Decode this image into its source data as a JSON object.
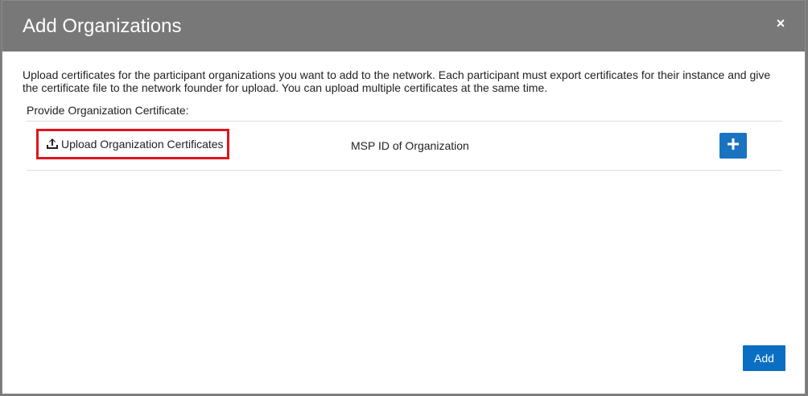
{
  "modal": {
    "title": "Add Organizations",
    "close_symbol": "×",
    "description": "Upload certificates for the participant organizations you want to add to the network. Each participant must export certificates for their instance and give the certificate file to the network founder for upload. You can upload multiple certificates at the same time.",
    "section_label": "Provide Organization Certificate:",
    "row": {
      "upload_label": "Upload Organization Certificates",
      "upload_icon": "upload-icon",
      "msp_label": "MSP ID of Organization",
      "plus_icon": "plus-icon"
    },
    "add_label": "Add"
  },
  "colors": {
    "header_bg": "#787878",
    "accent_blue": "#0a6fc2",
    "highlight_red": "#e0141e"
  }
}
